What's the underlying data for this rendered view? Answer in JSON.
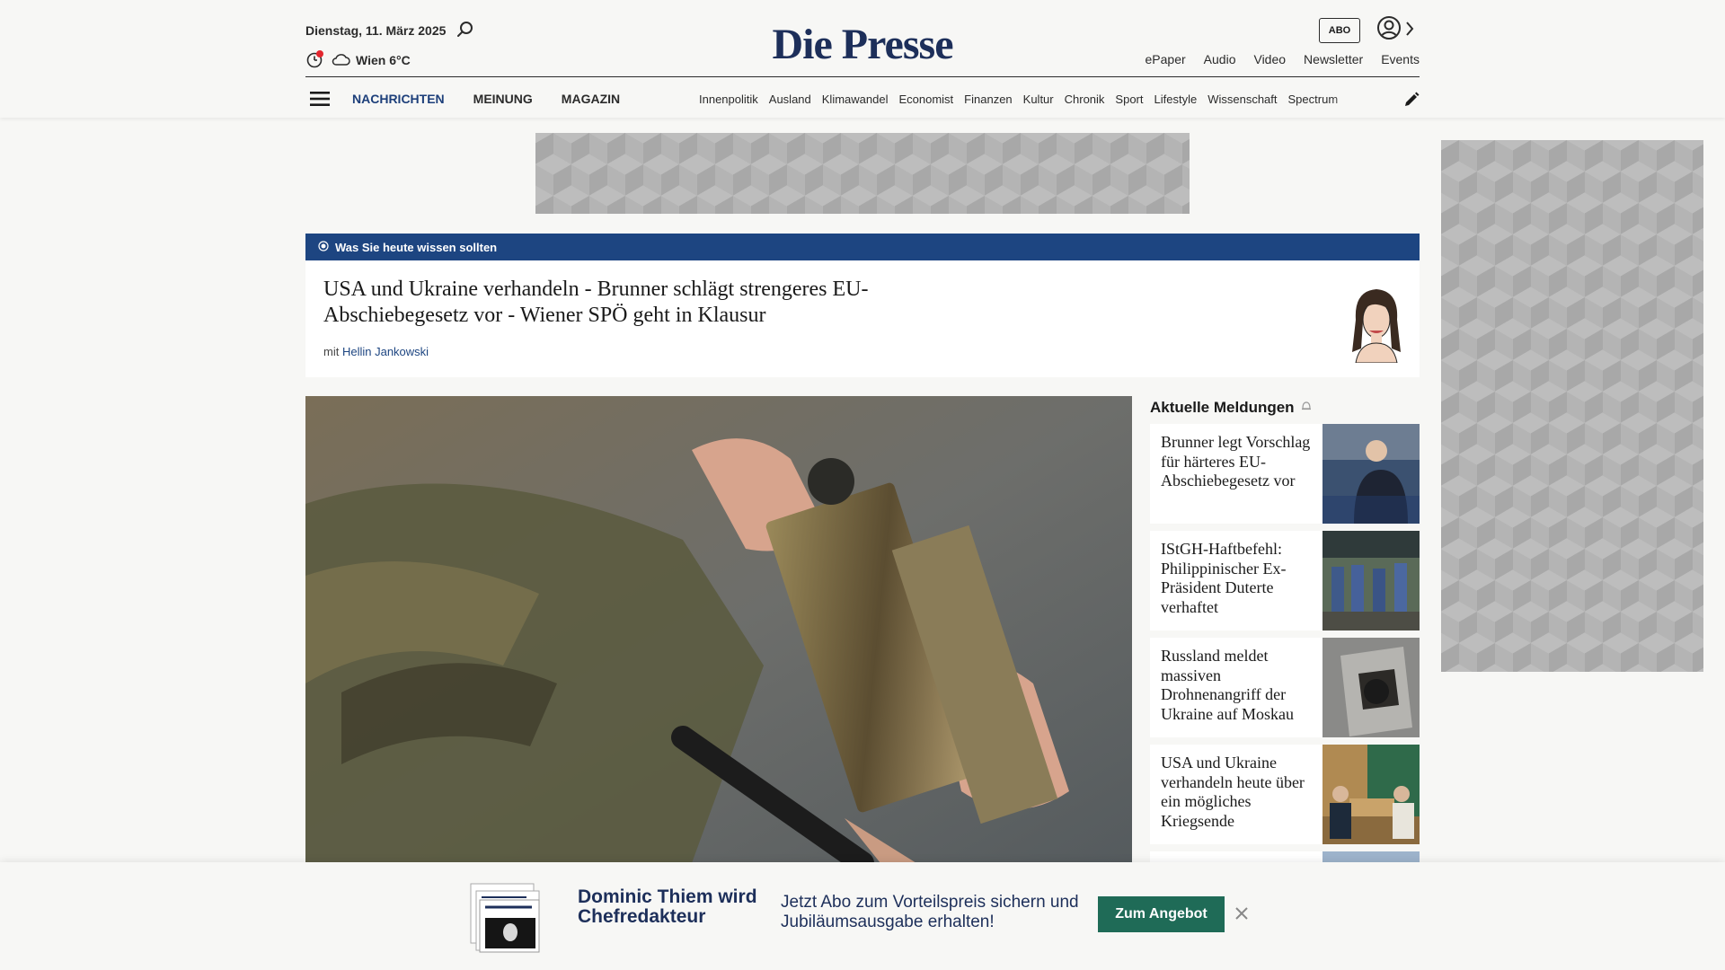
{
  "header": {
    "date": "Dienstag, 11. März 2025",
    "weather": "Wien 6°C",
    "logo": "Die Presse",
    "abo_label": "ABO",
    "top_links": [
      "ePaper",
      "Audio",
      "Video",
      "Newsletter",
      "Events"
    ],
    "primary_nav": [
      "NACHRICHTEN",
      "MEINUNG",
      "MAGAZIN"
    ],
    "secondary_nav": [
      "Innenpolitik",
      "Ausland",
      "Klimawandel",
      "Economist",
      "Finanzen",
      "Kultur",
      "Chronik",
      "Sport",
      "Lifestyle",
      "Wissenschaft",
      "Spectrum"
    ],
    "accent_color": "#1d4581",
    "logo_color": "#1d2f5a"
  },
  "briefing": {
    "label": "Was Sie heute wissen sollten",
    "headline": "USA und Ukraine verhandeln - Brunner schlägt strengeres EU-Abschiebegesetz vor - Wiener SPÖ geht in Klausur",
    "author_prefix": "mit",
    "author_name": "Hellin Jankowski"
  },
  "news": {
    "title": "Aktuelle Meldungen",
    "items": [
      {
        "text": "Brunner legt Vorschlag für härteres EU-Abschiebegesetz vor"
      },
      {
        "text": "IStGH-Haftbefehl: Philippinischer Ex-Präsident Duterte verhaftet"
      },
      {
        "text": "Russland meldet massiven Drohnenangriff der Ukraine auf Moskau"
      },
      {
        "text": "USA und Ukraine verhandeln heute über ein mögliches Kriegsende"
      }
    ]
  },
  "promo": {
    "name": "Dominic Thiem wird Chefredakteur",
    "offer": "Jetzt Abo zum Vorteilspreis sichern und Jubiläumsausgabe erhalten!",
    "cta": "Zum Angebot",
    "cta_color": "#1f6b57"
  }
}
